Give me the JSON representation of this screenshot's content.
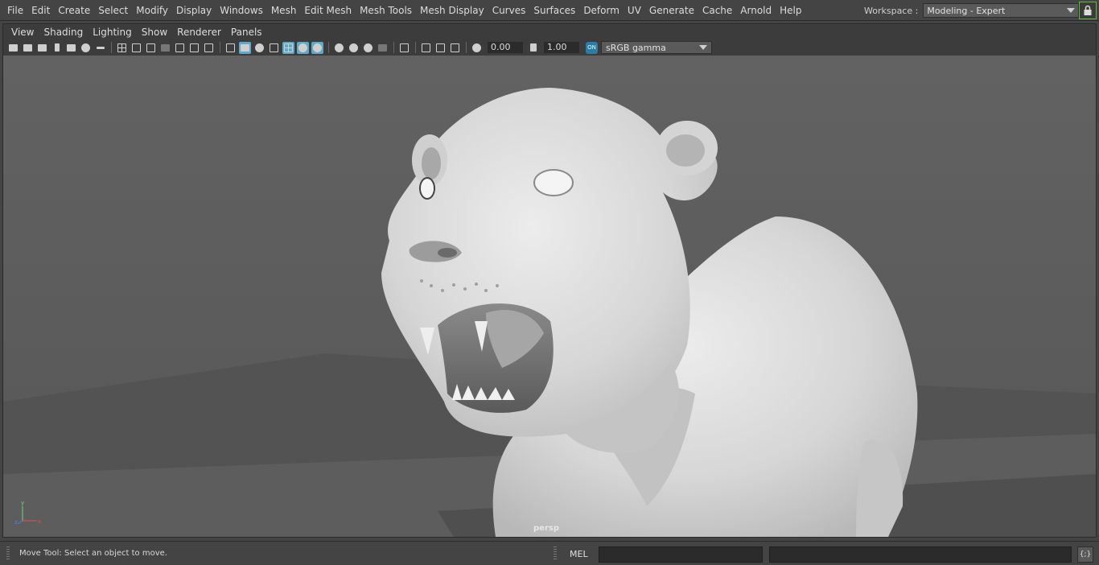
{
  "menubar": {
    "items": [
      "File",
      "Edit",
      "Create",
      "Select",
      "Modify",
      "Display",
      "Windows",
      "Mesh",
      "Edit Mesh",
      "Mesh Tools",
      "Mesh Display",
      "Curves",
      "Surfaces",
      "Deform",
      "UV",
      "Generate",
      "Cache",
      "Arnold",
      "Help"
    ]
  },
  "workspace": {
    "label": "Workspace :",
    "value": "Modeling - Expert"
  },
  "panel_menu": {
    "items": [
      "View",
      "Shading",
      "Lighting",
      "Show",
      "Renderer",
      "Panels"
    ]
  },
  "panel_toolbar": {
    "exposure": "0.00",
    "gamma": "1.00",
    "color_space": "sRGB gamma",
    "cm_badge": "ON"
  },
  "viewport": {
    "camera_label": "persp",
    "axis_y": "y",
    "axis_z": "z",
    "axis_x": "x"
  },
  "status": {
    "message": "Move Tool: Select an object to move.",
    "mel_label": "MEL",
    "script_editor_glyph": "{;}"
  },
  "colors": {
    "accent_active": "#5fa9c9",
    "lock_border": "#5fbf3a",
    "viewport_bg": "#606060"
  }
}
